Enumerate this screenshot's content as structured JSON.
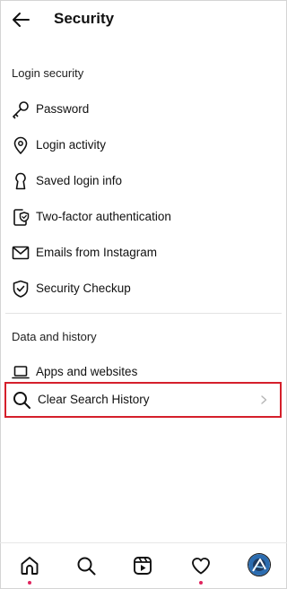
{
  "header": {
    "title": "Security",
    "back_icon": "arrow-left-icon"
  },
  "login_security": {
    "title": "Login security",
    "items": [
      {
        "label": "Password",
        "icon": "key-icon"
      },
      {
        "label": "Login activity",
        "icon": "location-pin-icon"
      },
      {
        "label": "Saved login info",
        "icon": "keyhole-icon"
      },
      {
        "label": "Two-factor authentication",
        "icon": "phone-shield-icon"
      },
      {
        "label": "Emails from Instagram",
        "icon": "envelope-icon"
      },
      {
        "label": "Security Checkup",
        "icon": "shield-check-icon"
      }
    ]
  },
  "data_history": {
    "title": "Data and history",
    "items": [
      {
        "label": "Apps and websites",
        "icon": "laptop-icon"
      },
      {
        "label": "Clear Search History",
        "icon": "search-icon",
        "highlighted": true
      }
    ]
  },
  "bottom_nav": {
    "items": [
      {
        "icon": "home-icon",
        "notification_dot": true
      },
      {
        "icon": "search-icon",
        "notification_dot": false
      },
      {
        "icon": "reels-icon",
        "notification_dot": false
      },
      {
        "icon": "heart-icon",
        "notification_dot": true
      },
      {
        "icon": "profile-avatar",
        "notification_dot": false
      }
    ]
  },
  "colors": {
    "highlight_border": "#d51f2b",
    "notification_dot": "#e0245e",
    "text": "#111111"
  }
}
